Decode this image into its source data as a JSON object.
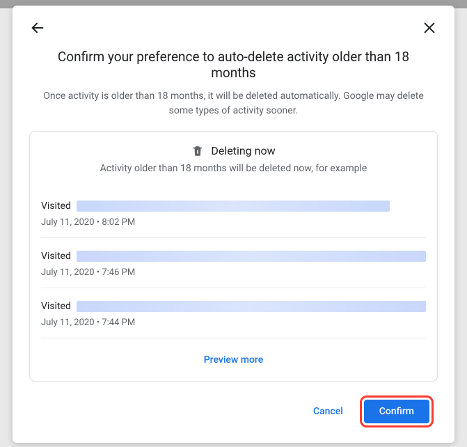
{
  "dialog": {
    "title": "Confirm your preference to auto-delete activity older than 18 months",
    "subtitle": "Once activity is older than 18 months, it will be deleted automatically. Google may delete some types of activity sooner."
  },
  "card": {
    "deleting_label": "Deleting now",
    "deleting_sub": "Activity older than 18 months will be deleted now, for example",
    "items": [
      {
        "action": "Visited",
        "timestamp": "July 11, 2020 • 8:02 PM"
      },
      {
        "action": "Visited",
        "timestamp": "July 11, 2020 • 7:46 PM"
      },
      {
        "action": "Visited",
        "timestamp": "July 11, 2020 • 7:44 PM"
      }
    ],
    "preview_more": "Preview more"
  },
  "actions": {
    "cancel": "Cancel",
    "confirm": "Confirm"
  }
}
